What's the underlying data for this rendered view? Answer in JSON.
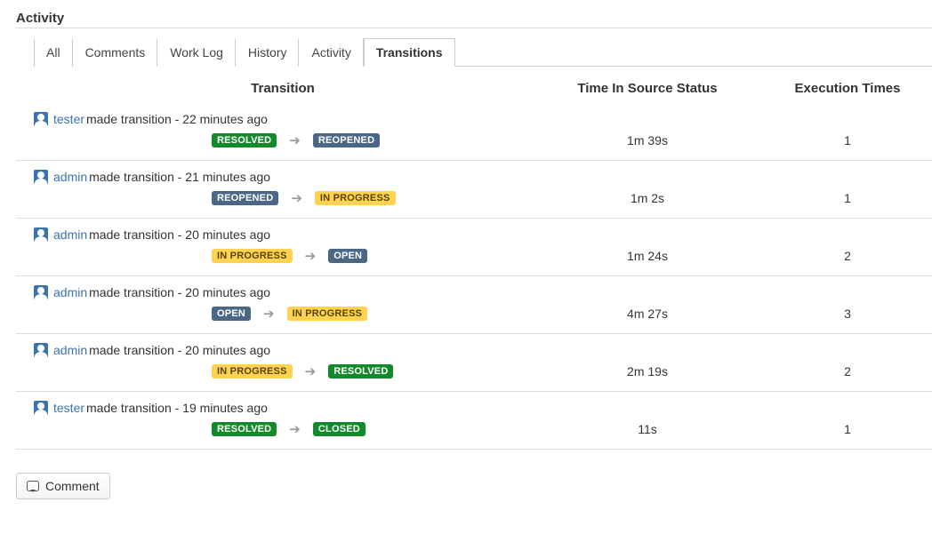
{
  "section_title": "Activity",
  "tabs": [
    {
      "label": "All",
      "active": false
    },
    {
      "label": "Comments",
      "active": false
    },
    {
      "label": "Work Log",
      "active": false
    },
    {
      "label": "History",
      "active": false
    },
    {
      "label": "Activity",
      "active": false
    },
    {
      "label": "Transitions",
      "active": true
    }
  ],
  "columns": {
    "transition": "Transition",
    "time_in_source": "Time In Source Status",
    "execution_times": "Execution Times"
  },
  "action_phrase": "made transition -",
  "status_styles": {
    "RESOLVED": "green",
    "CLOSED": "green",
    "REOPENED": "blue",
    "OPEN": "blue",
    "IN PROGRESS": "yellow"
  },
  "rows": [
    {
      "user": "tester",
      "when": "22 minutes ago",
      "from": "RESOLVED",
      "to": "REOPENED",
      "time": "1m 39s",
      "exec": "1"
    },
    {
      "user": "admin",
      "when": "21 minutes ago",
      "from": "REOPENED",
      "to": "IN PROGRESS",
      "time": "1m 2s",
      "exec": "1"
    },
    {
      "user": "admin",
      "when": "20 minutes ago",
      "from": "IN PROGRESS",
      "to": "OPEN",
      "time": "1m 24s",
      "exec": "2"
    },
    {
      "user": "admin",
      "when": "20 minutes ago",
      "from": "OPEN",
      "to": "IN PROGRESS",
      "time": "4m 27s",
      "exec": "3"
    },
    {
      "user": "admin",
      "when": "20 minutes ago",
      "from": "IN PROGRESS",
      "to": "RESOLVED",
      "time": "2m 19s",
      "exec": "2"
    },
    {
      "user": "tester",
      "when": "19 minutes ago",
      "from": "RESOLVED",
      "to": "CLOSED",
      "time": "11s",
      "exec": "1"
    }
  ],
  "comment_button": "Comment"
}
